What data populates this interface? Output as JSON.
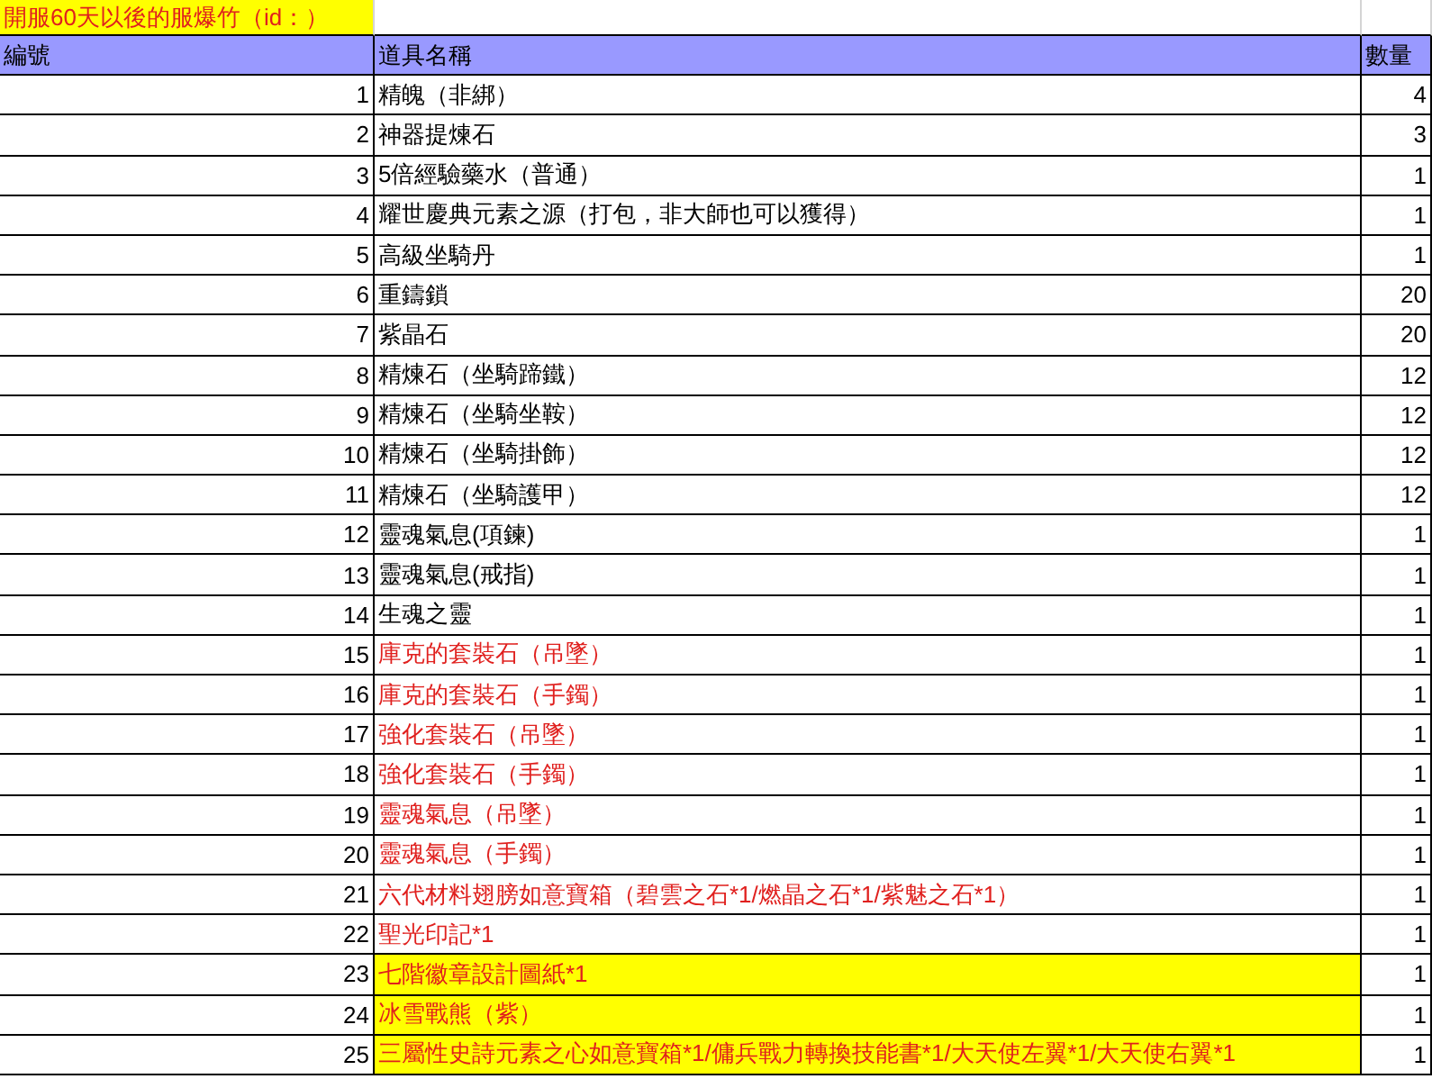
{
  "title": "開服60天以後的服爆竹（id：）",
  "columns": [
    "編號",
    "道具名稱",
    "數量"
  ],
  "rows": [
    {
      "no": "1",
      "name": "精魄（非綁）",
      "qty": "4",
      "kind": "plain"
    },
    {
      "no": "2",
      "name": "神器提煉石",
      "qty": "3",
      "kind": "plain"
    },
    {
      "no": "3",
      "name": "5倍經驗藥水（普通）",
      "qty": "1",
      "kind": "plain"
    },
    {
      "no": "4",
      "name": "耀世慶典元素之源（打包，非大師也可以獲得）",
      "qty": "1",
      "kind": "plain"
    },
    {
      "no": "5",
      "name": "高級坐騎丹",
      "qty": "1",
      "kind": "plain"
    },
    {
      "no": "6",
      "name": "重鑄鎖",
      "qty": "20",
      "kind": "plain"
    },
    {
      "no": "7",
      "name": "紫晶石",
      "qty": "20",
      "kind": "plain"
    },
    {
      "no": "8",
      "name": "精煉石（坐騎蹄鐵）",
      "qty": "12",
      "kind": "plain"
    },
    {
      "no": "9",
      "name": "精煉石（坐騎坐鞍）",
      "qty": "12",
      "kind": "plain"
    },
    {
      "no": "10",
      "name": "精煉石（坐騎掛飾）",
      "qty": "12",
      "kind": "plain"
    },
    {
      "no": "11",
      "name": "精煉石（坐騎護甲）",
      "qty": "12",
      "kind": "plain"
    },
    {
      "no": "12",
      "name": "靈魂氣息(項鍊)",
      "qty": "1",
      "kind": "plain"
    },
    {
      "no": "13",
      "name": "靈魂氣息(戒指)",
      "qty": "1",
      "kind": "plain"
    },
    {
      "no": "14",
      "name": "生魂之靈",
      "qty": "1",
      "kind": "plain"
    },
    {
      "no": "15",
      "name": "庫克的套裝石（吊墜）",
      "qty": "1",
      "kind": "red"
    },
    {
      "no": "16",
      "name": "庫克的套裝石（手鐲）",
      "qty": "1",
      "kind": "red"
    },
    {
      "no": "17",
      "name": "強化套裝石（吊墜）",
      "qty": "1",
      "kind": "red"
    },
    {
      "no": "18",
      "name": "強化套裝石（手鐲）",
      "qty": "1",
      "kind": "red"
    },
    {
      "no": "19",
      "name": "靈魂氣息（吊墜）",
      "qty": "1",
      "kind": "red"
    },
    {
      "no": "20",
      "name": "靈魂氣息（手鐲）",
      "qty": "1",
      "kind": "red"
    },
    {
      "no": "21",
      "name": "六代材料翅膀如意寶箱（碧雲之石*1/燃晶之石*1/紫魅之石*1）",
      "qty": "1",
      "kind": "red"
    },
    {
      "no": "22",
      "name": "聖光印記*1",
      "qty": "1",
      "kind": "red"
    },
    {
      "no": "23",
      "name": "七階徽章設計圖紙*1",
      "qty": "1",
      "kind": "highlight"
    },
    {
      "no": "24",
      "name": "冰雪戰熊（紫）",
      "qty": "1",
      "kind": "highlight"
    },
    {
      "no": "25",
      "name": "三屬性史詩元素之心如意寶箱*1/傭兵戰力轉換技能書*1/大天使左翼*1/大天使右翼*1",
      "qty": "1",
      "kind": "highlight"
    }
  ]
}
